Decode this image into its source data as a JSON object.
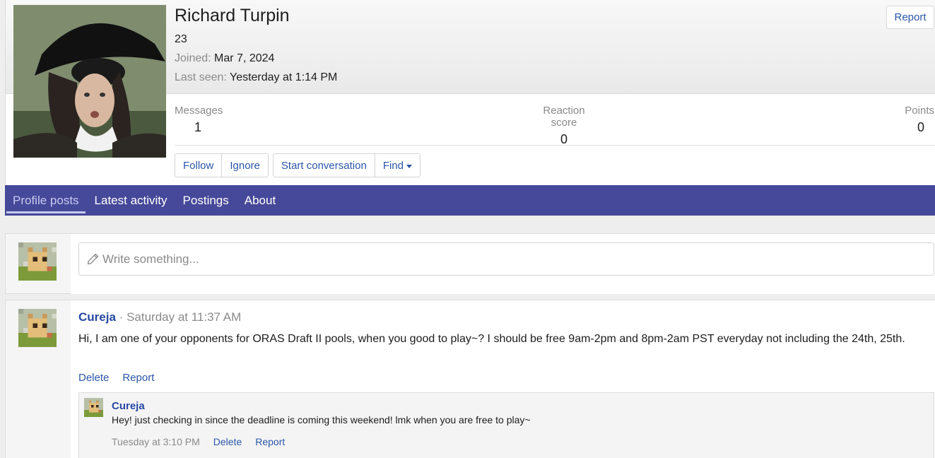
{
  "profile": {
    "username": "Richard Turpin",
    "custom_title": "23",
    "joined_label": "Joined:",
    "joined_value": "Mar 7, 2024",
    "last_seen_label": "Last seen:",
    "last_seen_value": "Yesterday at 1:14 PM",
    "report_label": "Report"
  },
  "stats": {
    "messages_label": "Messages",
    "messages_value": "1",
    "reaction_label": "Reaction score",
    "reaction_value": "0",
    "points_label": "Points",
    "points_value": "0"
  },
  "actions": {
    "follow": "Follow",
    "ignore": "Ignore",
    "start_conversation": "Start conversation",
    "find": "Find"
  },
  "tabs": [
    "Profile posts",
    "Latest activity",
    "Postings",
    "About"
  ],
  "composer": {
    "placeholder": "Write something..."
  },
  "post": {
    "author": "Cureja",
    "separator": "·",
    "time": "Saturday at 11:37 AM",
    "body": "Hi, I am one of your opponents for ORAS Draft II pools, when you good to play~? I should be free 9am-2pm and 8pm-2am PST everyday not including the 24th, 25th.",
    "delete_label": "Delete",
    "report_label": "Report"
  },
  "comment": {
    "author": "Cureja",
    "body": "Hey! just checking in since the deadline is coming this weekend! lmk when you are free to play~",
    "time": "Tuesday at 3:10 PM",
    "delete_label": "Delete",
    "report_label": "Report"
  },
  "colors": {
    "tab_bar": "#464899",
    "link": "#2b56a8",
    "username": "#2549a3"
  }
}
